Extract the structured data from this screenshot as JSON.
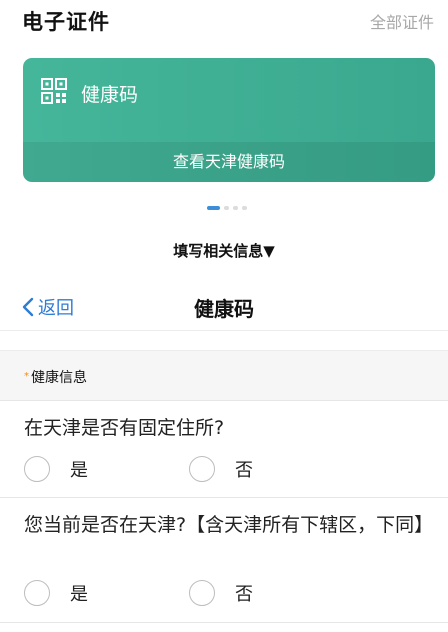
{
  "header": {
    "title": "电子证件",
    "all_link": "全部证件"
  },
  "card": {
    "title": "健康码",
    "action": "查看天津健康码",
    "icon": "qr-code-icon",
    "color": "#3aa88e"
  },
  "carousel": {
    "count": 4,
    "active": 0
  },
  "fill_info": "填写相关信息▼",
  "nav": {
    "back": "返回",
    "title": "健康码"
  },
  "section": {
    "required_mark": "*",
    "label": "健康信息"
  },
  "questions": [
    {
      "text": "在天津是否有固定住所?",
      "options": [
        "是",
        "否"
      ]
    },
    {
      "text": "您当前是否在天津?【含天津所有下辖区，下同】",
      "options": [
        "是",
        "否"
      ]
    }
  ],
  "colors": {
    "accent": "#2d7cd6",
    "card": "#3aa88e",
    "required": "#f08a1c"
  }
}
